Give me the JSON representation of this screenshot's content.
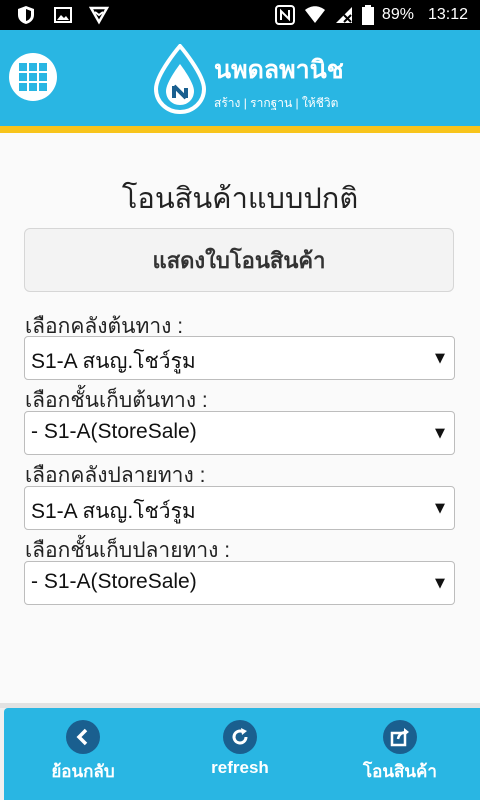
{
  "status_bar": {
    "battery": "89%",
    "time": "13:12"
  },
  "header": {
    "logo_name": "นพดลพานิช",
    "logo_tagline": "สร้าง | รากฐาน | ให้ชีวิต"
  },
  "page": {
    "title": "โอนสินค้าแบบปกติ",
    "show_button_label": "แสดงใบโอนสินค้า"
  },
  "fields": [
    {
      "label": "เลือกคลังต้นทาง :",
      "value": "S1-A สนญ.โชว์รูม"
    },
    {
      "label": "เลือกชั้นเก็บต้นทาง :",
      "value": "- S1-A(StoreSale)"
    },
    {
      "label": "เลือกคลังปลายทาง :",
      "value": "S1-A สนญ.โชว์รูม"
    },
    {
      "label": "เลือกชั้นเก็บปลายทาง :",
      "value": "- S1-A(StoreSale)"
    }
  ],
  "bottom_nav": [
    {
      "label": "ย้อนกลับ",
      "icon": "back-icon"
    },
    {
      "label": "refresh",
      "icon": "refresh-icon"
    },
    {
      "label": "โอนสินค้า",
      "icon": "share-icon"
    }
  ],
  "colors": {
    "primary": "#29b6e3",
    "accent": "#f7c41b",
    "nav_icon_bg": "#1a5f8f"
  }
}
